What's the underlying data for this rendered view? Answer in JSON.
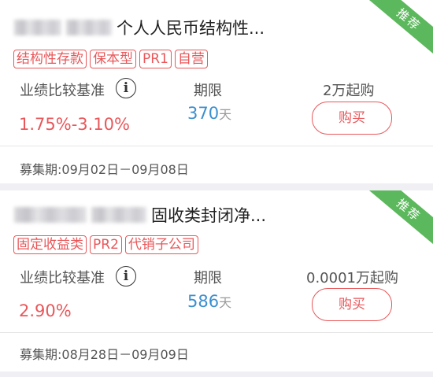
{
  "products": [
    {
      "title_suffix": "个人人民币结构性...",
      "ribbon": "推荐",
      "tags": [
        "结构性存款",
        "保本型",
        "PR1",
        "自营"
      ],
      "rate_label": "业绩比较基准",
      "rate_value": "1.75%-3.10%",
      "term_label": "期限",
      "term_days": "370",
      "term_unit": "天",
      "min_purchase": "2万起购",
      "buy_label": "购买",
      "raise_period": "募集期:09月02日－09月08日"
    },
    {
      "title_suffix": "固收类封闭净...",
      "ribbon": "推荐",
      "tags": [
        "固定收益类",
        "PR2",
        "代销子公司"
      ],
      "rate_label": "业绩比较基准",
      "rate_value": "2.90%",
      "term_label": "期限",
      "term_days": "586",
      "term_unit": "天",
      "min_purchase": "0.0001万起购",
      "buy_label": "购买",
      "raise_period": "募集期:08月28日－09月09日"
    }
  ],
  "icons": {
    "info": "i"
  },
  "colors": {
    "accent_red": "#e8575a",
    "term_blue": "#3b8fd0",
    "ribbon_green": "#5cb85c",
    "background": "#efeff4"
  }
}
